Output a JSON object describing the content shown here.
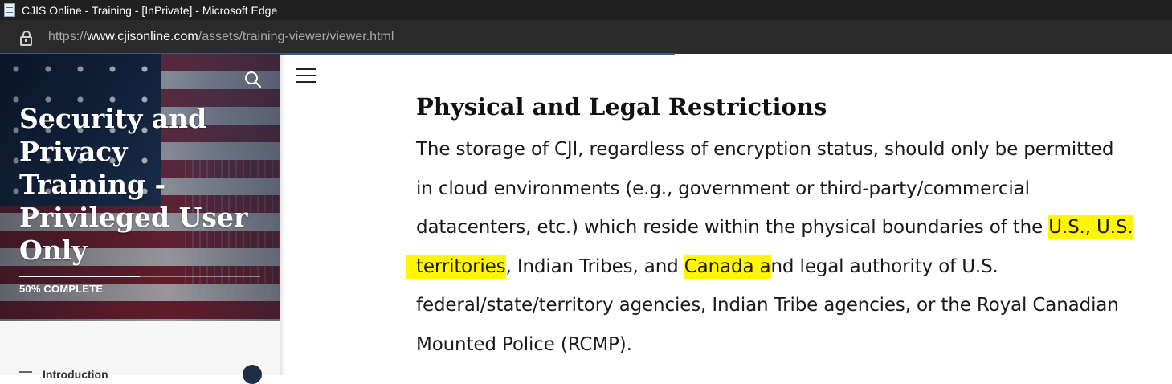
{
  "browser": {
    "window_title": "CJIS Online - Training - [InPrivate] - Microsoft Edge",
    "url_prefix": "https://",
    "url_host": "www.cjisonline.com",
    "url_path": "/assets/training-viewer/viewer.html"
  },
  "sidebar": {
    "course_title": "Security and Privacy Training - Privileged User Only",
    "progress_text": "50% COMPLETE",
    "progress_fraction": 0.5,
    "outline_first_item": "Introduction",
    "outline_first_item_completed": true
  },
  "content": {
    "heading": "Physical and Legal Restrictions",
    "line1": "The storage of CJI, regardless of encryption status, should only be permitted",
    "line2": "in cloud environments (e.g., government or third-party/commercial",
    "line3_text": "datacenters, etc.) which reside within the physical boundaries of the ",
    "line3_highlight": "U.S., U.S.",
    "line4_highlight1": "territories",
    "line4_text1": ", Indian Tribes, and ",
    "line4_highlight2": "Canada a",
    "line4_text2": "nd legal authority of U.S.",
    "line5": "federal/state/territory agencies, Indian Tribe agencies, or the Royal Canadian",
    "line6": "Mounted Police (RCMP).",
    "highlight_color": "#fff600"
  }
}
